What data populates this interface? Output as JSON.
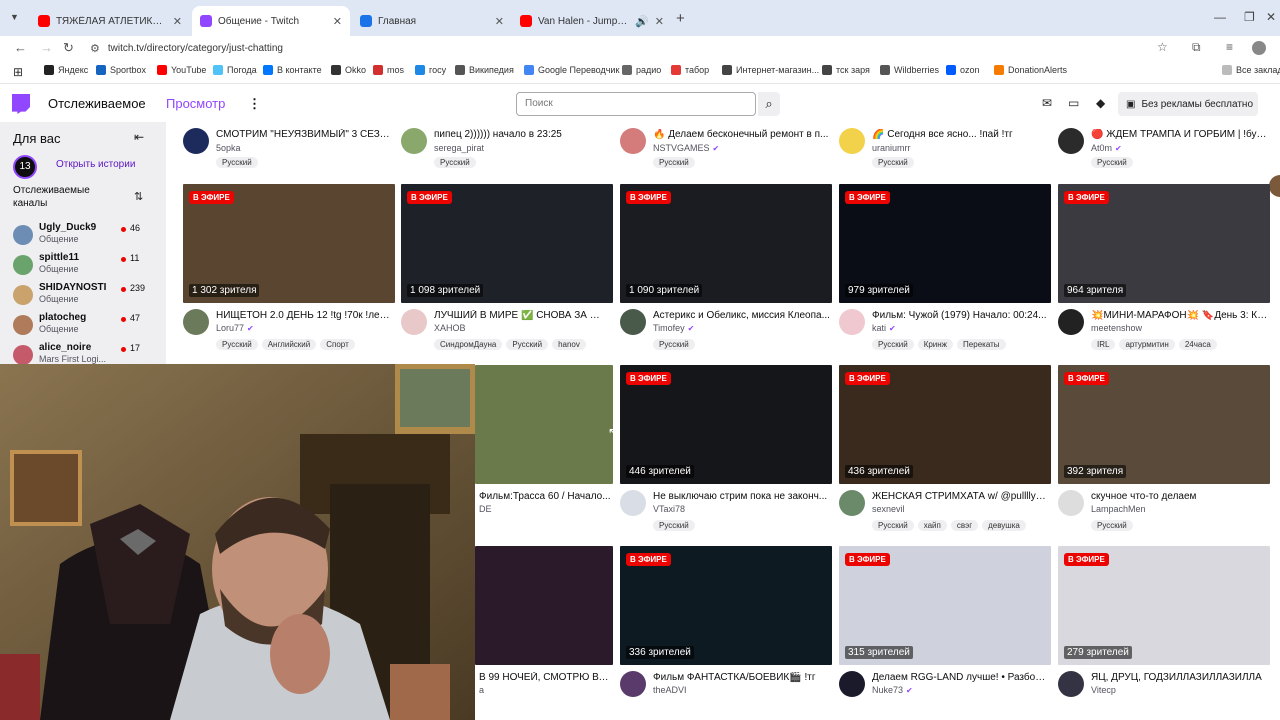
{
  "browser": {
    "tabs": [
      {
        "title": "ТЯЖЁЛАЯ АТЛЕТИКА - СТОН",
        "color": "#ff0000",
        "active": false
      },
      {
        "title": "Общение - Twitch",
        "color": "#9146ff",
        "active": true
      },
      {
        "title": "Главная",
        "color": "#1a73e8",
        "active": false
      },
      {
        "title": "Van Halen - Jump (Official",
        "color": "#ff0000",
        "active": false
      }
    ],
    "url": "twitch.tv/directory/category/just-chatting",
    "bookmarks": [
      {
        "label": "Яндекс",
        "color": "#222"
      },
      {
        "label": "Sportbox",
        "color": "#1565c0"
      },
      {
        "label": "YouTube",
        "color": "#ff0000"
      },
      {
        "label": "Погода",
        "color": "#4fc3f7"
      },
      {
        "label": "В контакте",
        "color": "#0077ff"
      },
      {
        "label": "Okko",
        "color": "#333"
      },
      {
        "label": "mos",
        "color": "#d32f2f"
      },
      {
        "label": "госу",
        "color": "#1e88e5"
      },
      {
        "label": "Википедия",
        "color": "#555"
      },
      {
        "label": "Google Переводчик",
        "color": "#4285f4"
      },
      {
        "label": "радио",
        "color": "#666"
      },
      {
        "label": "табор",
        "color": "#e53935"
      },
      {
        "label": "Интернет-магазин...",
        "color": "#444"
      },
      {
        "label": "тск заря",
        "color": "#444"
      },
      {
        "label": "Wildberries",
        "color": "#555"
      },
      {
        "label": "ozon",
        "color": "#005bff"
      },
      {
        "label": "DonationAlerts",
        "color": "#f57c00"
      }
    ],
    "all_bookmarks": "Все заклад"
  },
  "twitch": {
    "nav_following": "Отслеживаемое",
    "nav_browse": "Просмотр",
    "search_placeholder": "Поиск",
    "no_ads": "Без рекламы бесплатно"
  },
  "sidebar": {
    "header": "Для вас",
    "stories": "Открыть истории",
    "stories_avatar": "13",
    "followed_label": "Отслеживаемые каналы",
    "channels": [
      {
        "name": "Ugly_Duck9",
        "category": "Общение",
        "viewers": "46",
        "color": "#6d8db5"
      },
      {
        "name": "spittle11",
        "category": "Общение",
        "viewers": "11",
        "color": "#6aa36b"
      },
      {
        "name": "SHIDAYNOSTI",
        "category": "Общение",
        "viewers": "239",
        "color": "#c9a36b"
      },
      {
        "name": "platocheg",
        "category": "Общение",
        "viewers": "47",
        "color": "#b07b5a"
      },
      {
        "name": "alice_noire",
        "category": "Mars First Logi...",
        "viewers": "17",
        "color": "#c45a6a"
      }
    ]
  },
  "cards_top": [
    {
      "title": "СМОТРИМ \"НЕУЯЗВИМЫЙ\" 3 СЕЗОН...",
      "channel": "5opka",
      "tags": [
        "Русский"
      ],
      "color": "#1d2a5c"
    },
    {
      "title": "пипец 2)))))) начало в 23:25",
      "channel": "serega_pirat",
      "tags": [
        "Русский"
      ],
      "color": "#8aa86b"
    },
    {
      "title": "🔥 Делаем бесконечный ремонт в п...",
      "channel": "NSTVGAMES",
      "tags": [
        "Русский"
      ],
      "color": "#d47b7b",
      "verified": true
    },
    {
      "title": "🌈 Сегодня все ясно... !пай !тг",
      "channel": "uraniumrr",
      "tags": [
        "Русский"
      ],
      "color": "#f2d24b"
    },
    {
      "title": "🔴 ЖДЕМ ТРАМПА И ГОРБИМ | !бутк...",
      "channel": "At0m",
      "tags": [
        "Русский"
      ],
      "color": "#2b2b2b",
      "verified": true
    }
  ],
  "cards_row1": [
    {
      "viewers": "1 302 зрителя",
      "title": "НИЩЕТОН 2.0 ДЕНЬ 12 !tg !70к !лев !...",
      "channel": "Loru77",
      "tags": [
        "Русский",
        "Английский",
        "Спорт"
      ],
      "live": "В ЭФИРЕ",
      "thumb": "#5a4630",
      "avatar": "#6a7a5a",
      "verified": true
    },
    {
      "viewers": "1 098 зрителей",
      "title": "ЛУЧШИЙ В МИРЕ ✅ СНОВА ЗА ✅ Р...",
      "channel": "XAHOB",
      "tags": [
        "СиндромДауна",
        "Русский",
        "hanov"
      ],
      "live": "В ЭФИРЕ",
      "thumb": "#1e2228",
      "avatar": "#e8c8c8"
    },
    {
      "viewers": "1 090 зрителей",
      "title": "Астерикс и Обеликс, миссия Клеопа...",
      "channel": "Timofey",
      "tags": [
        "Русский"
      ],
      "live": "В ЭФИРЕ",
      "thumb": "#1a1c22",
      "avatar": "#4a5a4a",
      "verified": true
    },
    {
      "viewers": "979 зрителей",
      "title": "Фильм: Чужой (1979) Начало: 00:24...",
      "channel": "kati",
      "tags": [
        "Русский",
        "Кринж",
        "Перекаты"
      ],
      "live": "В ЭФИРЕ",
      "thumb": "#0b0d16",
      "avatar": "#f0c8d0",
      "verified": true
    },
    {
      "viewers": "964 зрителя",
      "title": "💥МИНИ-МАРАФОН💥 🔖День 3: КУ...",
      "channel": "meetenshow",
      "tags": [
        "IRL",
        "артурмитин",
        "24часа"
      ],
      "live": "В ЭФИРЕ",
      "thumb": "#3a3a40",
      "avatar": "#222"
    }
  ],
  "cards_row2": [
    {
      "viewers": "",
      "title": "Фильм:Трасса 60 / Начало...",
      "channel": "DE",
      "tags": [],
      "live": "",
      "thumb": "#6b7a4a",
      "avatar": ""
    },
    {
      "viewers": "446 зрителей",
      "title": "Не выключаю стрим пока не законч...",
      "channel": "VTaxi78",
      "tags": [
        "Русский"
      ],
      "live": "В ЭФИРЕ",
      "thumb": "#15161a",
      "avatar": "#d8dde6"
    },
    {
      "viewers": "436 зрителей",
      "title": "ЖЕНСКАЯ СТРИМХАТА w/ @pullllya ...",
      "channel": "sexnevil",
      "tags": [
        "Русский",
        "хайп",
        "свэг",
        "девушка"
      ],
      "live": "В ЭФИРЕ",
      "thumb": "#3a2a1e",
      "avatar": "#6a8a6a"
    },
    {
      "viewers": "392 зрителя",
      "title": "скучное что-то делаем",
      "channel": "LampachMen",
      "tags": [
        "Русский"
      ],
      "live": "В ЭФИРЕ",
      "thumb": "#5a4a3a",
      "avatar": "#ddd"
    }
  ],
  "cards_row3": [
    {
      "viewers": "",
      "title": "В 99 НОЧЕЙ, СМОТРЮ ВА...",
      "channel": "a",
      "live": "",
      "thumb": "#2a1a2a",
      "avatar": ""
    },
    {
      "viewers": "336 зрителей",
      "title": "Фильм ФАНТАСТКА/БОЕВИК🎬 !тг",
      "channel": "theADVI",
      "live": "В ЭФИРЕ",
      "thumb": "#0e1a22",
      "avatar": "#5a3a6a"
    },
    {
      "viewers": "315 зрителей",
      "title": "Делаем RGG-LAND лучше! • Разбор ...",
      "channel": "Nuke73",
      "live": "В ЭФИРЕ",
      "thumb": "#cfd2dc",
      "avatar": "#1a1a2a",
      "verified": true
    },
    {
      "viewers": "279 зрителей",
      "title": "ЯЦ, ДРУЦ, ГОДЗИЛЛАЗИЛЛАЗИЛЛА",
      "channel": "Vitecp",
      "live": "В ЭФИРЕ",
      "thumb": "#d8d8de",
      "avatar": "#334"
    }
  ]
}
